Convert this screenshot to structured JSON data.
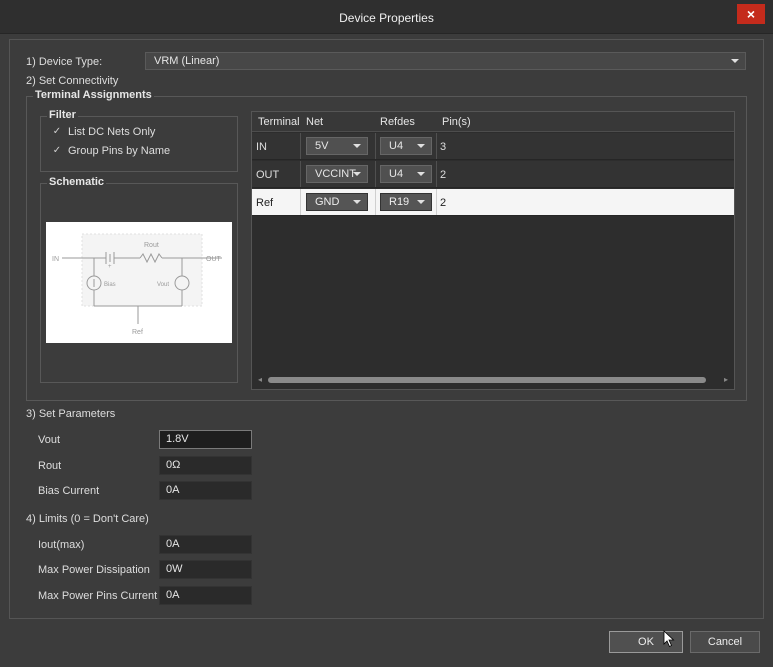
{
  "window": {
    "title": "Device Properties",
    "close_label": "×"
  },
  "device_type": {
    "label": "1) Device Type:",
    "value": "VRM (Linear)"
  },
  "connectivity": {
    "section_label": "2) Set Connectivity",
    "terminal_group_label": "Terminal Assignments",
    "filter": {
      "title": "Filter",
      "list_dc_nets_only": {
        "label": "List DC Nets Only",
        "checked": true
      },
      "group_pins_by_name": {
        "label": "Group Pins by Name",
        "checked": true
      }
    },
    "schematic": {
      "title": "Schematic",
      "labels": {
        "in": "IN",
        "out": "OUT",
        "rout": "Rout",
        "bias": "Bias",
        "vout": "Vout",
        "ref": "Ref",
        "plus": "+"
      }
    },
    "table": {
      "columns": [
        "Terminal",
        "Net",
        "Refdes",
        "Pin(s)"
      ],
      "rows": [
        {
          "terminal": "IN",
          "net": "5V",
          "refdes": "U4",
          "pins": "3",
          "selected": false
        },
        {
          "terminal": "OUT",
          "net": "VCCINT",
          "refdes": "U4",
          "pins": "2",
          "selected": false
        },
        {
          "terminal": "Ref",
          "net": "GND",
          "refdes": "R19",
          "pins": "2",
          "selected": true
        }
      ]
    }
  },
  "parameters": {
    "section_label": "3) Set Parameters",
    "vout": {
      "label": "Vout",
      "value": "1.8V"
    },
    "rout": {
      "label": "Rout",
      "value": "0Ω"
    },
    "bias_current": {
      "label": "Bias Current",
      "value": "0A"
    }
  },
  "limits": {
    "section_label": "4) Limits (0 = Don't Care)",
    "iout_max": {
      "label": "Iout(max)",
      "value": "0A"
    },
    "max_power_dissipation": {
      "label": "Max Power Dissipation",
      "value": "0W"
    },
    "max_power_pins_current": {
      "label": "Max Power Pins Current",
      "value": "0A"
    }
  },
  "buttons": {
    "ok": "OK",
    "cancel": "Cancel"
  },
  "icons": {
    "close": "close-icon",
    "check": "checkmark-icon",
    "dropdown": "chevron-down-icon",
    "cursor": "mouse-pointer-icon"
  }
}
